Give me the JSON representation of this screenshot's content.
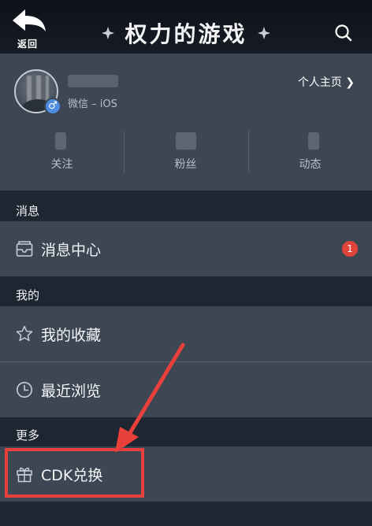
{
  "header": {
    "back_label": "返回",
    "title": "权力的游戏"
  },
  "profile": {
    "platform": "微信 – iOS",
    "homepage_link": "个人主页 ❯",
    "gender_symbol": "♂"
  },
  "stats": [
    {
      "label": "关注"
    },
    {
      "label": "粉丝"
    },
    {
      "label": "动态"
    }
  ],
  "sections": {
    "messages": {
      "title": "消息",
      "items": [
        {
          "label": "消息中心",
          "badge": "1"
        }
      ]
    },
    "mine": {
      "title": "我的",
      "items": [
        {
          "label": "我的收藏"
        },
        {
          "label": "最近浏览"
        }
      ]
    },
    "more": {
      "title": "更多",
      "items": [
        {
          "label": "CDK兑换"
        }
      ]
    }
  },
  "colors": {
    "background": "#1e2631",
    "panel": "#3d4653",
    "badge": "#e0453c",
    "annotation": "#e8403b",
    "gender_badge": "#4f8de0"
  },
  "icons": [
    "back-arrow-icon",
    "search-icon",
    "message-icon",
    "star-icon",
    "clock-icon",
    "gift-icon"
  ]
}
